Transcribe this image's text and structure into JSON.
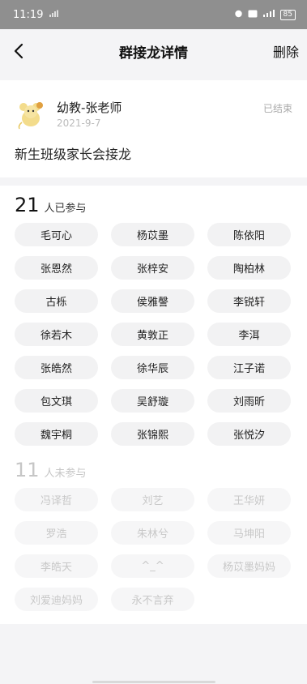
{
  "status_bar": {
    "time": "11:19",
    "signal": "᪤",
    "battery": "85"
  },
  "nav": {
    "title": "群接龙详情",
    "delete_label": "删除"
  },
  "post": {
    "author_name": "幼教-张老师",
    "date": "2021-9-7",
    "status": "已结束",
    "title": "新生班级家长会接龙"
  },
  "joined": {
    "count": "21",
    "label": "人已参与",
    "names": [
      "毛可心",
      "杨苡墨",
      "陈依阳",
      "张恩然",
      "张梓安",
      "陶柏林",
      "古栎",
      "侯雅謦",
      "李锐轩",
      "徐若木",
      "黄敦正",
      "李洱",
      "张皓然",
      "徐华辰",
      "江子诺",
      "包文琪",
      "吴舒璇",
      "刘雨昕",
      "魏宇桐",
      "张锦熙",
      "张悦汐"
    ]
  },
  "not_joined": {
    "count": "11",
    "label": "人未参与",
    "names": [
      "冯译哲",
      "刘艺",
      "王华妍",
      "罗浩",
      "朱林兮",
      "马坤阳",
      "李皓天",
      "^_^",
      "杨苡墨妈妈",
      "刘爱迪妈妈",
      "永不言弃"
    ]
  },
  "colors": {
    "statusbar": "#8f8f8f",
    "chip_bg": "#f2f2f3",
    "muted_text": "#c8c8c8"
  }
}
